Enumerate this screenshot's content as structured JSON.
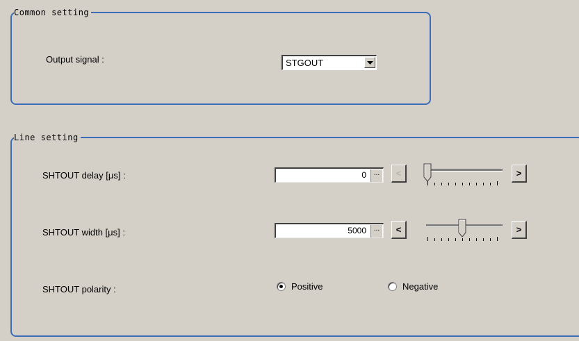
{
  "common": {
    "title": "Common setting",
    "output_signal_label": "Output signal :",
    "output_signal_value": "STGOUT"
  },
  "line": {
    "title": "Line setting",
    "delay": {
      "label": "SHTOUT delay [μs] :",
      "value": "0",
      "ellipsis": "...",
      "dec": "<",
      "inc": ">",
      "slider_fraction": 0.0,
      "dec_enabled": false
    },
    "width": {
      "label": "SHTOUT width [μs] :",
      "value": "5000",
      "ellipsis": "...",
      "dec": "<",
      "inc": ">",
      "slider_fraction": 0.5,
      "dec_enabled": true
    },
    "polarity": {
      "label": "SHTOUT polarity :",
      "options": [
        "Positive",
        "Negative"
      ],
      "selected": "Positive"
    }
  },
  "colors": {
    "frame": "#3d6cb8",
    "background": "#d4d0c8"
  }
}
